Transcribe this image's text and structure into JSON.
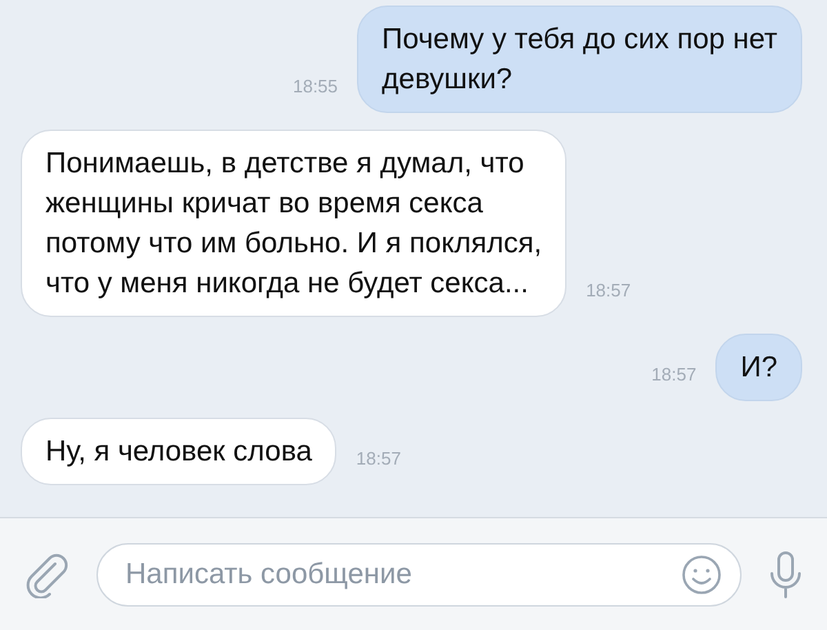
{
  "messages": [
    {
      "kind": "outgoing",
      "lines": [
        "Почему у тебя до сих пор нет",
        "девушки?"
      ],
      "time": "18:55"
    },
    {
      "kind": "incoming",
      "lines": [
        "Понимаешь, в детстве я думал, что",
        "женщины кричат во время секса",
        "потому что им больно. И я поклялся,",
        "что у меня никогда не будет секса..."
      ],
      "time": "18:57"
    },
    {
      "kind": "outgoing",
      "lines": [
        "И?"
      ],
      "time": "18:57"
    },
    {
      "kind": "incoming",
      "lines": [
        "Ну, я человек слова"
      ],
      "time": "18:57"
    }
  ],
  "composer": {
    "placeholder": "Написать сообщение"
  }
}
